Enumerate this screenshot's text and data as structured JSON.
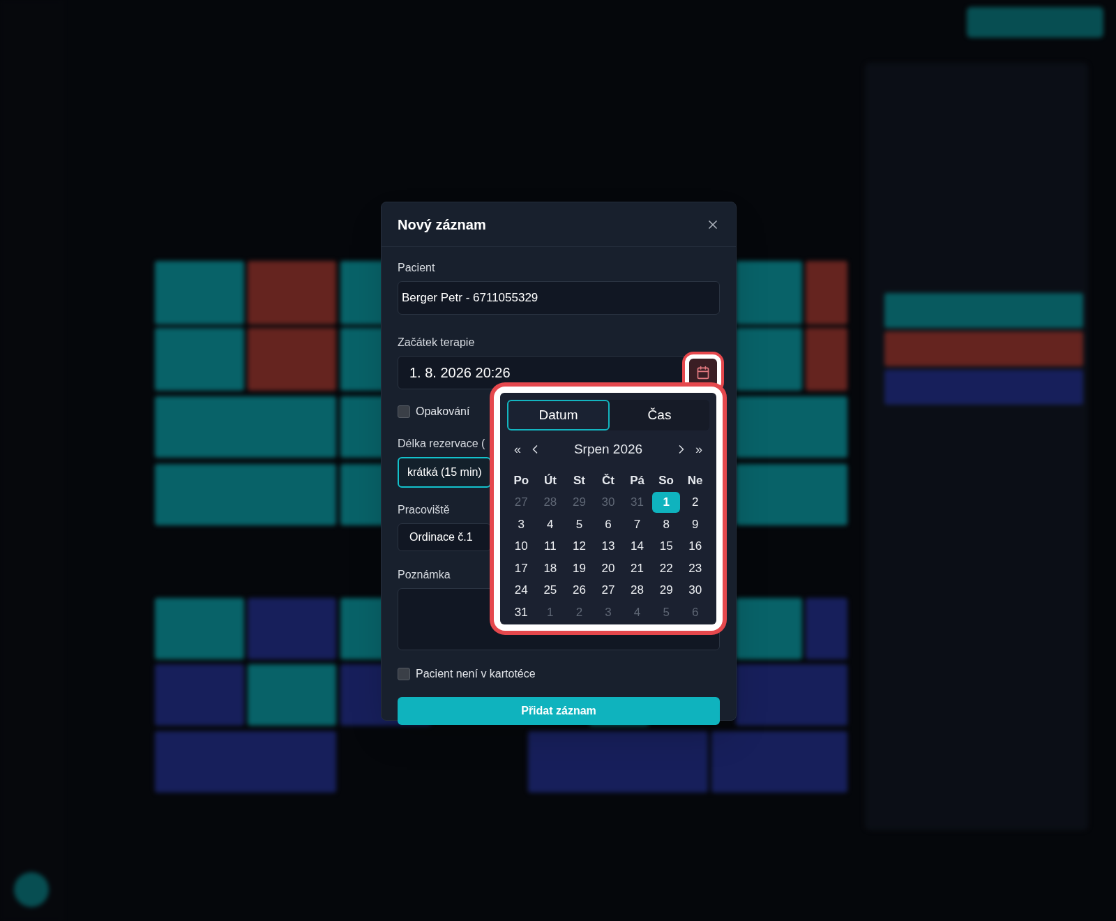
{
  "dialog": {
    "title": "Nový záznam",
    "patient": {
      "label": "Pacient",
      "value": "Berger Petr - 6711055329"
    },
    "start": {
      "label": "Začátek terapie",
      "value": "1. 8. 2026 20:26"
    },
    "recurrence": {
      "label": "Opakování",
      "checked": false
    },
    "duration": {
      "label": "Délka rezervace (",
      "value": "krátká (15 min)",
      "focused": true
    },
    "workplace": {
      "label": "Pracoviště",
      "value": "Ordinace č.1"
    },
    "note": {
      "label": "Poznámka"
    },
    "not_in_registry": {
      "label": "Pacient není v kartotéce",
      "checked": false
    },
    "submit": "Přidat záznam"
  },
  "picker": {
    "tabs": [
      {
        "label": "Datum",
        "selected": true
      },
      {
        "label": "Čas",
        "selected": false
      }
    ],
    "first": "«",
    "last": "»",
    "month": "Srpen 2026",
    "weekdays": [
      "Po",
      "Út",
      "St",
      "Čt",
      "Pá",
      "So",
      "Ne"
    ],
    "days": [
      {
        "label": "27",
        "outside": true,
        "selected": false
      },
      {
        "label": "28",
        "outside": true,
        "selected": false
      },
      {
        "label": "29",
        "outside": true,
        "selected": false
      },
      {
        "label": "30",
        "outside": true,
        "selected": false
      },
      {
        "label": "31",
        "outside": true,
        "selected": false
      },
      {
        "label": "1",
        "outside": false,
        "selected": true
      },
      {
        "label": "2",
        "outside": false,
        "selected": false
      },
      {
        "label": "3",
        "outside": false,
        "selected": false
      },
      {
        "label": "4",
        "outside": false,
        "selected": false
      },
      {
        "label": "5",
        "outside": false,
        "selected": false
      },
      {
        "label": "6",
        "outside": false,
        "selected": false
      },
      {
        "label": "7",
        "outside": false,
        "selected": false
      },
      {
        "label": "8",
        "outside": false,
        "selected": false
      },
      {
        "label": "9",
        "outside": false,
        "selected": false
      },
      {
        "label": "10",
        "outside": false,
        "selected": false
      },
      {
        "label": "11",
        "outside": false,
        "selected": false
      },
      {
        "label": "12",
        "outside": false,
        "selected": false
      },
      {
        "label": "13",
        "outside": false,
        "selected": false
      },
      {
        "label": "14",
        "outside": false,
        "selected": false
      },
      {
        "label": "15",
        "outside": false,
        "selected": false
      },
      {
        "label": "16",
        "outside": false,
        "selected": false
      },
      {
        "label": "17",
        "outside": false,
        "selected": false
      },
      {
        "label": "18",
        "outside": false,
        "selected": false
      },
      {
        "label": "19",
        "outside": false,
        "selected": false
      },
      {
        "label": "20",
        "outside": false,
        "selected": false
      },
      {
        "label": "21",
        "outside": false,
        "selected": false
      },
      {
        "label": "22",
        "outside": false,
        "selected": false
      },
      {
        "label": "23",
        "outside": false,
        "selected": false
      },
      {
        "label": "24",
        "outside": false,
        "selected": false
      },
      {
        "label": "25",
        "outside": false,
        "selected": false
      },
      {
        "label": "26",
        "outside": false,
        "selected": false
      },
      {
        "label": "27",
        "outside": false,
        "selected": false
      },
      {
        "label": "28",
        "outside": false,
        "selected": false
      },
      {
        "label": "29",
        "outside": false,
        "selected": false
      },
      {
        "label": "30",
        "outside": false,
        "selected": false
      },
      {
        "label": "31",
        "outside": false,
        "selected": false
      },
      {
        "label": "1",
        "outside": true,
        "selected": false
      },
      {
        "label": "2",
        "outside": true,
        "selected": false
      },
      {
        "label": "3",
        "outside": true,
        "selected": false
      },
      {
        "label": "4",
        "outside": true,
        "selected": false
      },
      {
        "label": "5",
        "outside": true,
        "selected": false
      },
      {
        "label": "6",
        "outside": true,
        "selected": false
      }
    ]
  }
}
